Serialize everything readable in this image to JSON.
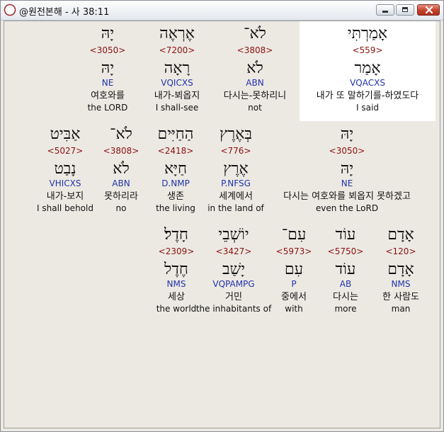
{
  "window": {
    "title": "@원전본해 - 사 38:11",
    "app_icon": "compass-icon",
    "controls": [
      "minimize-icon",
      "maximize-icon",
      "close-icon"
    ],
    "accent": "#c4412c"
  },
  "colors": {
    "strong": "#8b1010",
    "parse": "#2233aa",
    "highlight": "#ffffff"
  },
  "rows": [
    [
      {
        "heb": "אָמַרְתִּי",
        "strong": "<559>",
        "root": "אָמַר",
        "parse": "VQACXS",
        "kor": "내가 또 말하기를-하였도다",
        "eng": "I said",
        "highlighted": true
      },
      {
        "heb": "לֹא־",
        "strong": "<3808>",
        "root": "לֹא",
        "parse": "ABN",
        "kor": "다시는-못하리니",
        "eng": "not"
      },
      {
        "heb": "אֶרְאֶה",
        "strong": "<7200>",
        "root": "רָאָה",
        "parse": "VQICXS",
        "kor": "내가-뵈옵지",
        "eng": "I shall-see"
      },
      {
        "heb": "יָהּ",
        "strong": "<3050>",
        "root": "יָהּ",
        "parse": "NE",
        "kor": "여호와를",
        "eng": "the LORD"
      }
    ],
    [
      {
        "heb": "יָהּ",
        "strong": "<3050>",
        "root": "יָהּ",
        "parse": "NE",
        "kor": "다시는 여호와를 뵈옵지 못하겠고",
        "eng": "even the LoRD"
      },
      {
        "heb": "בְּאֶרֶץ",
        "strong": "<776>",
        "root": "אֶרֶץ",
        "parse": "P.NFSG",
        "kor": "세계에서",
        "eng": "in the land of"
      },
      {
        "heb": "הַחַיִּים",
        "strong": "<2418>",
        "root": "חַיָּא",
        "parse": "D.NMP",
        "kor": "생존",
        "eng": "the living"
      },
      {
        "heb": "לֹא־",
        "strong": "<3808>",
        "root": "לֹא",
        "parse": "ABN",
        "kor": "못하리라",
        "eng": "no"
      },
      {
        "heb": "אַבִּיט",
        "strong": "<5027>",
        "root": "נָבַט",
        "parse": "VHICXS",
        "kor": "내가-보지",
        "eng": "I shall behold"
      }
    ],
    [
      {
        "heb": "אָדָם",
        "strong": "<120>",
        "root": "אָדָם",
        "parse": "NMS",
        "kor": "한 사람도",
        "eng": "man"
      },
      {
        "heb": "עוֹד",
        "strong": "<5750>",
        "root": "עוֹד",
        "parse": "AB",
        "kor": "다시는",
        "eng": "more"
      },
      {
        "heb": "עִם־",
        "strong": "<5973>",
        "root": "עִם",
        "parse": "P",
        "kor": "중에서",
        "eng": "with"
      },
      {
        "heb": "יוֹשְׁבֵי",
        "strong": "<3427>",
        "root": "יָשַׁב",
        "parse": "VQPAMPG",
        "kor": "거민",
        "eng": "the inhabitants of"
      },
      {
        "heb": "חָדֶל׃",
        "strong": "<2309>",
        "root": "חֶדֶל",
        "parse": "NMS",
        "kor": "세상",
        "eng": "the world"
      }
    ]
  ]
}
